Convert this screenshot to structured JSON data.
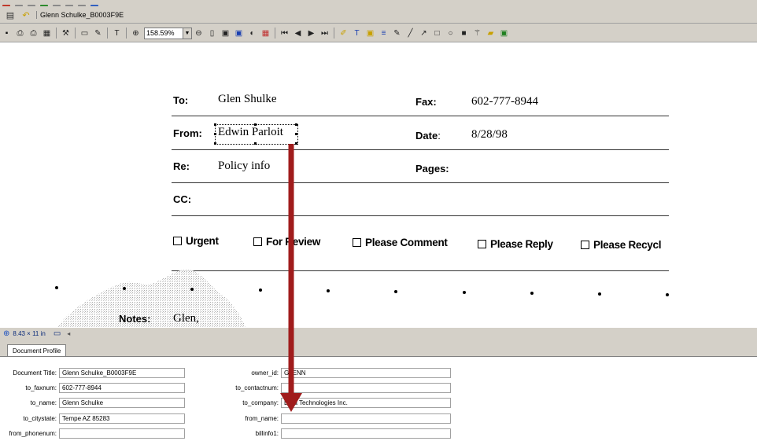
{
  "titlebar": {
    "document_name": "Glenn Schulke_B0003F9E"
  },
  "toolbar": {
    "zoom_value": "158.59%"
  },
  "fax": {
    "to_label": "To:",
    "to_value": "Glen Shulke",
    "fax_label": "Fax:",
    "fax_value": "602-777-8944",
    "from_label": "From:",
    "from_value": "Edwin Parloit",
    "date_label": "Date",
    "date_colon": ":",
    "date_value": "8/28/98",
    "re_label": "Re:",
    "re_value": "Policy info",
    "pages_label": "Pages:",
    "cc_label": "CC:",
    "checkboxes": [
      "Urgent",
      "For Review",
      "Please Comment",
      "Please Reply",
      "Please Recycl"
    ],
    "notes_label": "Notes:",
    "notes_value": "Glen,"
  },
  "statusbar": {
    "page_size": "8.43 × 11 in"
  },
  "panel": {
    "tab_label": "Document Profile",
    "left_fields": [
      {
        "label": "Document Title:",
        "value": "Glenn Schulke_B0003F9E"
      },
      {
        "label": "to_faxnum:",
        "value": "602-777-8944"
      },
      {
        "label": "to_name:",
        "value": "Glenn Schulke"
      },
      {
        "label": "to_citystate:",
        "value": "Tempe AZ 85283"
      },
      {
        "label": "from_phonenum:",
        "value": ""
      }
    ],
    "right_fields": [
      {
        "label": "owner_id:",
        "value": "GLENN"
      },
      {
        "label": "to_contactnum:",
        "value": ""
      },
      {
        "label": "to_company:",
        "value": "Data Technologies Inc."
      },
      {
        "label": "from_name:",
        "value": ""
      },
      {
        "label": "billinfo1:",
        "value": ""
      }
    ]
  },
  "colors": {
    "arrow": "#a01c1c",
    "status_text": "#0a2a7a"
  }
}
